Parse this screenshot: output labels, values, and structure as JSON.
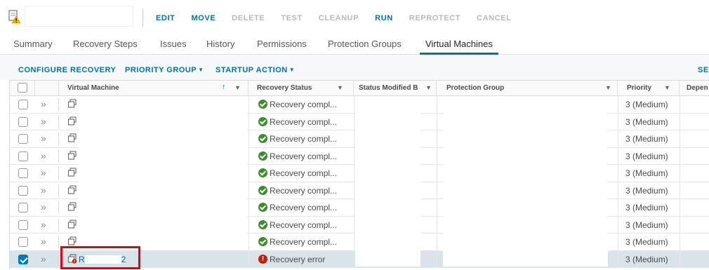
{
  "toolbar": {
    "plan_icon": "recovery-plan-warning-icon",
    "actions": [
      {
        "label": "EDIT",
        "enabled": true
      },
      {
        "label": "MOVE",
        "enabled": true
      },
      {
        "label": "DELETE",
        "enabled": false
      },
      {
        "label": "TEST",
        "enabled": false
      },
      {
        "label": "CLEANUP",
        "enabled": false
      },
      {
        "label": "RUN",
        "enabled": true
      },
      {
        "label": "REPROTECT",
        "enabled": false
      },
      {
        "label": "CANCEL",
        "enabled": false
      }
    ]
  },
  "tabs": [
    {
      "label": "Summary",
      "active": false
    },
    {
      "label": "Recovery Steps",
      "active": false
    },
    {
      "label": "Issues",
      "active": false
    },
    {
      "label": "History",
      "active": false
    },
    {
      "label": "Permissions",
      "active": false
    },
    {
      "label": "Protection Groups",
      "active": false
    },
    {
      "label": "Virtual Machines",
      "active": true
    }
  ],
  "grid_toolbar": {
    "configure_recovery": "CONFIGURE RECOVERY",
    "priority_group": "PRIORITY GROUP",
    "startup_action": "STARTUP ACTION",
    "truncated_right": "SE"
  },
  "grid": {
    "columns": {
      "vm": "Virtual Machine",
      "recovery_status": "Recovery Status",
      "status_modified": "Status Modified B",
      "protection_group": "Protection Group",
      "priority": "Priority",
      "dependencies_truncated": "Depen"
    },
    "rows": [
      {
        "vm_name": "",
        "status": "Recovery compl...",
        "status_type": "ok",
        "priority": "3 (Medium)",
        "selected": false
      },
      {
        "vm_name": "",
        "status": "Recovery compl...",
        "status_type": "ok",
        "priority": "3 (Medium)",
        "selected": false
      },
      {
        "vm_name": "",
        "status": "Recovery compl...",
        "status_type": "ok",
        "priority": "3 (Medium)",
        "selected": false
      },
      {
        "vm_name": "",
        "status": "Recovery compl...",
        "status_type": "ok",
        "priority": "3 (Medium)",
        "selected": false
      },
      {
        "vm_name": "",
        "status": "Recovery compl...",
        "status_type": "ok",
        "priority": "3 (Medium)",
        "selected": false
      },
      {
        "vm_name": "",
        "status": "Recovery compl...",
        "status_type": "ok",
        "priority": "3 (Medium)",
        "selected": false
      },
      {
        "vm_name": "",
        "status": "Recovery compl...",
        "status_type": "ok",
        "priority": "3 (Medium)",
        "selected": false
      },
      {
        "vm_name": "",
        "status": "Recovery compl...",
        "status_type": "ok",
        "priority": "3 (Medium)",
        "selected": false
      },
      {
        "vm_name": "",
        "status": "Recovery compl...",
        "status_type": "ok",
        "priority": "3 (Medium)",
        "selected": false
      },
      {
        "vm_name_prefix": "R",
        "vm_name_suffix": "2",
        "status": "Recovery error",
        "status_type": "error",
        "priority": "3 (Medium)",
        "selected": true
      }
    ]
  },
  "colors": {
    "accent": "#0072a3",
    "ok": "#3c8d2f",
    "error": "#c21d00",
    "highlight_box": "#e8000b",
    "selected_row": "#d9e4ea"
  }
}
